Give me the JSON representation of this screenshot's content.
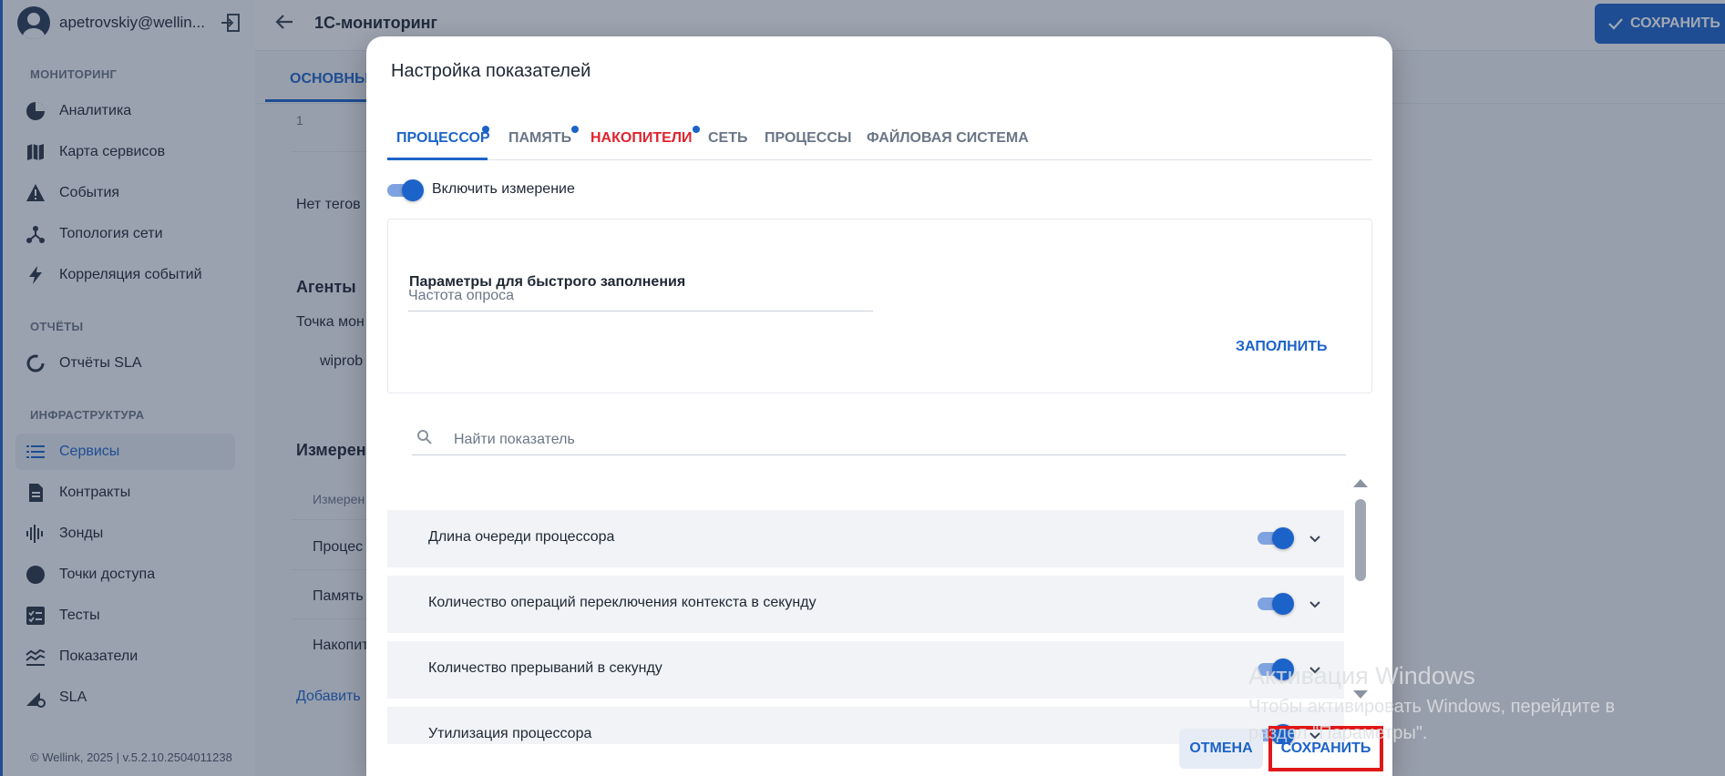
{
  "sidebar": {
    "user_name": "apetrovskiy@wellin...",
    "sections": {
      "monitoring": "МОНИТОРИНГ",
      "reports": "ОТЧЁТЫ",
      "infrastructure": "ИНФРАСТРУКТУРА"
    },
    "items": [
      {
        "label": "Аналитика",
        "icon": "pie-chart-icon"
      },
      {
        "label": "Карта сервисов",
        "icon": "map-icon"
      },
      {
        "label": "События",
        "icon": "warning-icon"
      },
      {
        "label": "Топология сети",
        "icon": "topology-icon"
      },
      {
        "label": "Корреляция событий",
        "icon": "bolt-icon"
      },
      {
        "label": "Отчёты SLA",
        "icon": "circle-progress-icon"
      },
      {
        "label": "Сервисы",
        "icon": "list-icon",
        "active": true
      },
      {
        "label": "Контракты",
        "icon": "document-icon"
      },
      {
        "label": "Зонды",
        "icon": "signal-icon"
      },
      {
        "label": "Точки доступа",
        "icon": "dot-icon"
      },
      {
        "label": "Тесты",
        "icon": "checklist-icon"
      },
      {
        "label": "Показатели",
        "icon": "chart-lines-icon"
      },
      {
        "label": "SLA",
        "icon": "sla-gear-icon"
      }
    ],
    "footer": "© Wellink, 2025 | v.5.2.10.2504011238"
  },
  "page": {
    "title": "1С-мониторинг",
    "save_label": "СОХРАНИТЬ",
    "main_tab": "ОСНОВНЫЕ",
    "row_number": "1",
    "no_tags": "Нет тегов",
    "agents_heading": "Агенты",
    "agents_point": "Точка мон",
    "agents_value": "wiprob",
    "measurements_heading": "Измерен",
    "measurements_col": "Измерен",
    "m_row1": "Процес",
    "m_row2": "Память",
    "m_row3": "Накопит",
    "add_link": "Добавить"
  },
  "modal": {
    "title": "Настройка показателей",
    "tabs": [
      {
        "label": "ПРОЦЕССОР",
        "dot": true
      },
      {
        "label": "ПАМЯТЬ",
        "dot": true
      },
      {
        "label": "НАКОПИТЕЛИ",
        "dot": true
      },
      {
        "label": "СЕТЬ",
        "dot": false
      },
      {
        "label": "ПРОЦЕССЫ",
        "dot": false
      },
      {
        "label": "ФАЙЛОВАЯ СИСТЕМА",
        "dot": false
      }
    ],
    "enable_label": "Включить измерение",
    "quick_title": "Параметры для быстрого заполнения",
    "freq_placeholder": "Частота опроса",
    "fill_label": "ЗАПОЛНИТЬ",
    "search_placeholder": "Найти показатель",
    "metrics": [
      "Длина очереди процессора",
      "Количество операций переключения контекста в секунду",
      "Количество прерываний в секунду",
      "Утилизация процессора"
    ],
    "cancel_label": "ОТМЕНА",
    "save_label": "СОХРАНИТЬ"
  },
  "watermark": {
    "title": "Активация Windows",
    "line1": "Чтобы активировать Windows, перейдите в",
    "line2": "раздел \"Параметры\"."
  },
  "colors": {
    "accent": "#1c63c9",
    "error": "#e0232e",
    "highlight": "#e01818"
  }
}
